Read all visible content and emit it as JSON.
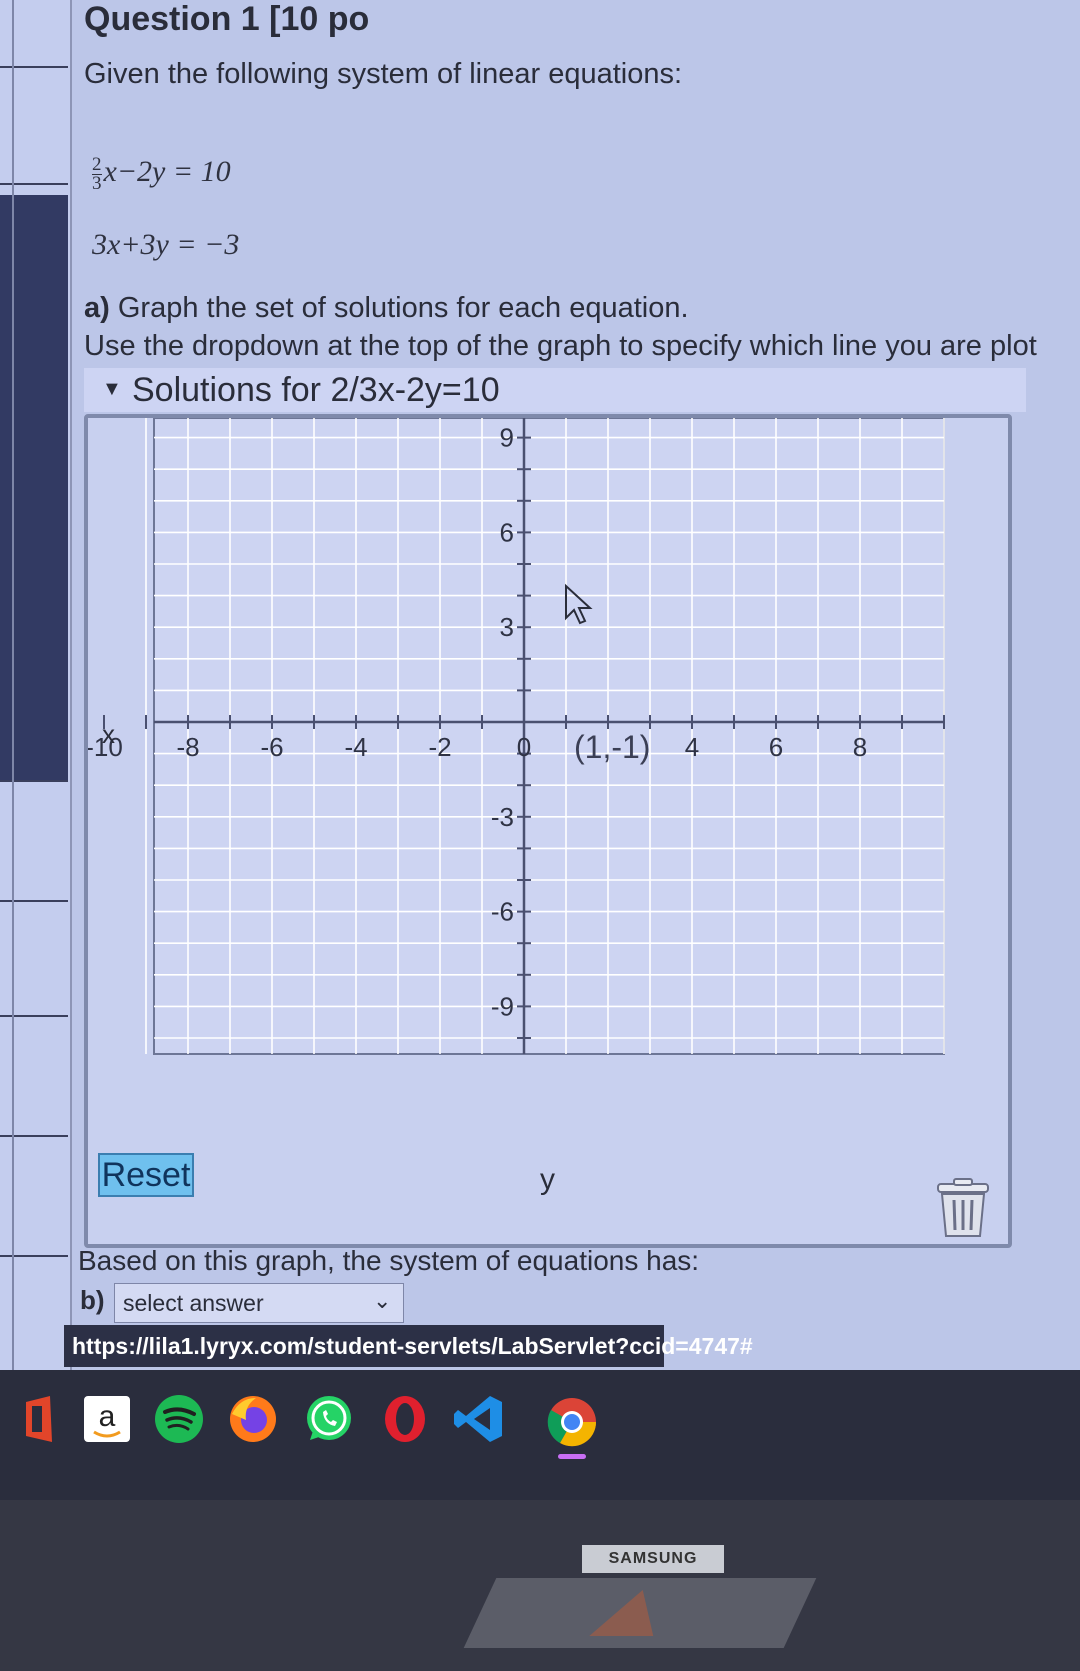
{
  "question": {
    "title": "Question 1 [10 po",
    "intro": "Given the following system of linear equations:",
    "equation1": {
      "fraction_num": "2",
      "fraction_den": "3",
      "rest": "x−2y  =  10"
    },
    "equation2": "3x+3y  =  −3"
  },
  "part_a": {
    "label": "a)",
    "text": "Graph the set of solutions for each equation.",
    "hint": "Use the dropdown at the top of the graph to specify which line you are plot"
  },
  "graph": {
    "dropdown_label": "Solutions for 2/3x-2y=10",
    "x_axis_label": "x",
    "y_axis_label": "y",
    "x_tick_labels": [
      "-10",
      "-8",
      "-6",
      "-4",
      "-2",
      "0",
      "4",
      "6",
      "8"
    ],
    "y_tick_labels": [
      "9",
      "6",
      "3",
      "-3",
      "-6",
      "-9"
    ],
    "point_label": "(1,-1)",
    "reset_label": "Reset"
  },
  "part_b": {
    "prompt": "Based on this graph, the system of equations has:",
    "label": "b)",
    "select_value": "select answer"
  },
  "url": "https://lila1.lyryx.com/student-servlets/LabServlet?ccid=4747#",
  "taskbar": {
    "icons": [
      "office-icon",
      "amazon-icon",
      "spotify-icon",
      "firefox-icon",
      "whatsapp-icon",
      "opera-icon",
      "vscode-icon",
      "chrome-icon"
    ],
    "amazon_letter": "a"
  },
  "monitor_brand": "SAMSUNG",
  "colors": {
    "reset_button": "#6fc0ee",
    "spotify": "#1db954",
    "whatsapp": "#25d366",
    "opera": "#e0202e",
    "vscode": "#1e8ee6"
  }
}
